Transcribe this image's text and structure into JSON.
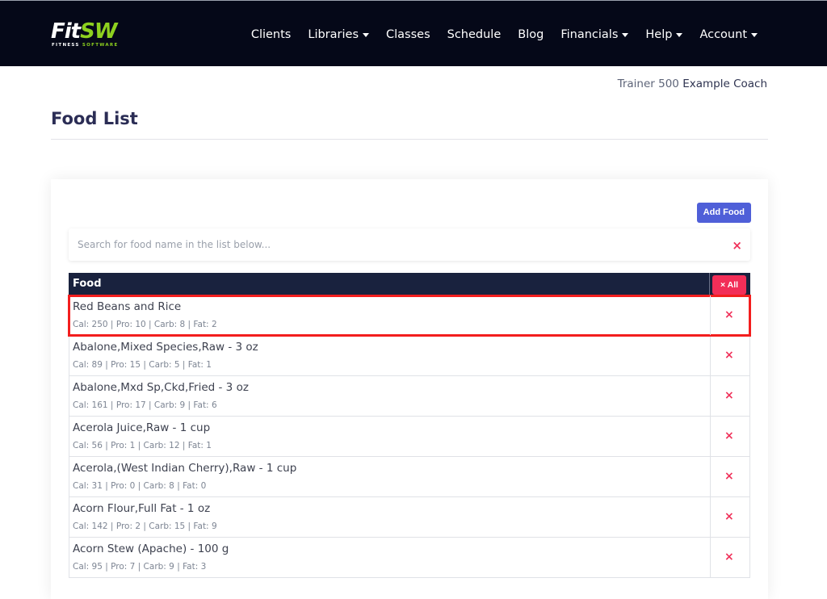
{
  "brand": {
    "logo_main": "Fit",
    "logo_accent": "SW",
    "logo_sub_main": "FITNESS ",
    "logo_sub_accent": "SOFTWARE",
    "accent_color": "#8ed11f"
  },
  "nav": {
    "items": [
      {
        "label": "Clients",
        "dropdown": false
      },
      {
        "label": "Libraries",
        "dropdown": true
      },
      {
        "label": "Classes",
        "dropdown": false
      },
      {
        "label": "Schedule",
        "dropdown": false
      },
      {
        "label": "Blog",
        "dropdown": false
      },
      {
        "label": "Financials",
        "dropdown": true
      },
      {
        "label": "Help",
        "dropdown": true
      },
      {
        "label": "Account",
        "dropdown": true
      }
    ]
  },
  "user": {
    "role": "Trainer 500",
    "name": "Example Coach"
  },
  "page": {
    "title": "Food List"
  },
  "toolbar": {
    "add_food_label": "Add Food"
  },
  "search": {
    "value": "",
    "placeholder": "Search for food name in the list below...",
    "clear_icon": "×"
  },
  "table": {
    "header_food": "Food",
    "delete_all_label": "× All",
    "delete_icon": "×",
    "rows": [
      {
        "name": "Red Beans and Rice",
        "macros": "Cal: 250 | Pro: 10 | Carb: 8 | Fat: 2",
        "highlighted": true
      },
      {
        "name": "Abalone,Mixed Species,Raw - 3 oz",
        "macros": "Cal: 89 | Pro: 15 | Carb: 5 | Fat: 1"
      },
      {
        "name": "Abalone,Mxd Sp,Ckd,Fried - 3 oz",
        "macros": "Cal: 161 | Pro: 17 | Carb: 9 | Fat: 6"
      },
      {
        "name": "Acerola Juice,Raw - 1 cup",
        "macros": "Cal: 56 | Pro: 1 | Carb: 12 | Fat: 1"
      },
      {
        "name": "Acerola,(West Indian Cherry),Raw - 1 cup",
        "macros": "Cal: 31 | Pro: 0 | Carb: 8 | Fat: 0"
      },
      {
        "name": "Acorn Flour,Full Fat - 1 oz",
        "macros": "Cal: 142 | Pro: 2 | Carb: 15 | Fat: 9"
      },
      {
        "name": "Acorn Stew (Apache) - 100 g",
        "macros": "Cal: 95 | Pro: 7 | Carb: 9 | Fat: 3"
      }
    ]
  }
}
